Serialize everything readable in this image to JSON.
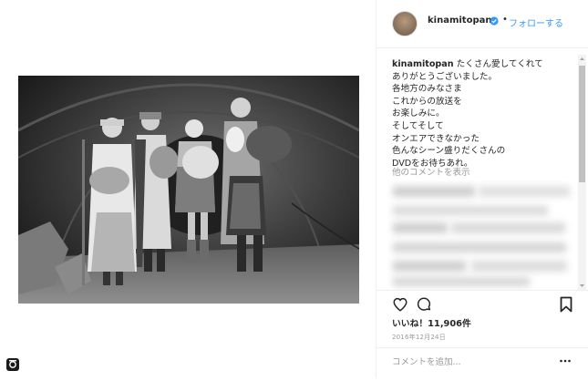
{
  "post": {
    "username": "kinamitopan",
    "dot": "•",
    "follow_label": "フォローする",
    "caption_user": "kinamitopan",
    "caption_lines": [
      "たくさん愛してくれて",
      "ありがとうございました。",
      "各地方のみなさま",
      "これからの放送を",
      "お楽しみに。",
      "そしてそして",
      "オンエアできなかった",
      "色んなシーン盛りだくさんの",
      "DVDをお待ちあれ。"
    ],
    "more_comments": "他のコメントを表示",
    "likes": "いいね！11,906件",
    "date": "2016年12月24日",
    "comment_placeholder": "コメントを追加..."
  },
  "colors": {
    "link": "#3897f0",
    "text": "#262626",
    "muted": "#999999",
    "border": "#efefef"
  },
  "icons": {
    "verified": "verified-badge-icon",
    "like": "heart-icon",
    "comment": "comment-bubble-icon",
    "save": "bookmark-icon",
    "more": "more-options-icon",
    "corner": "instagram-glyph-icon"
  }
}
